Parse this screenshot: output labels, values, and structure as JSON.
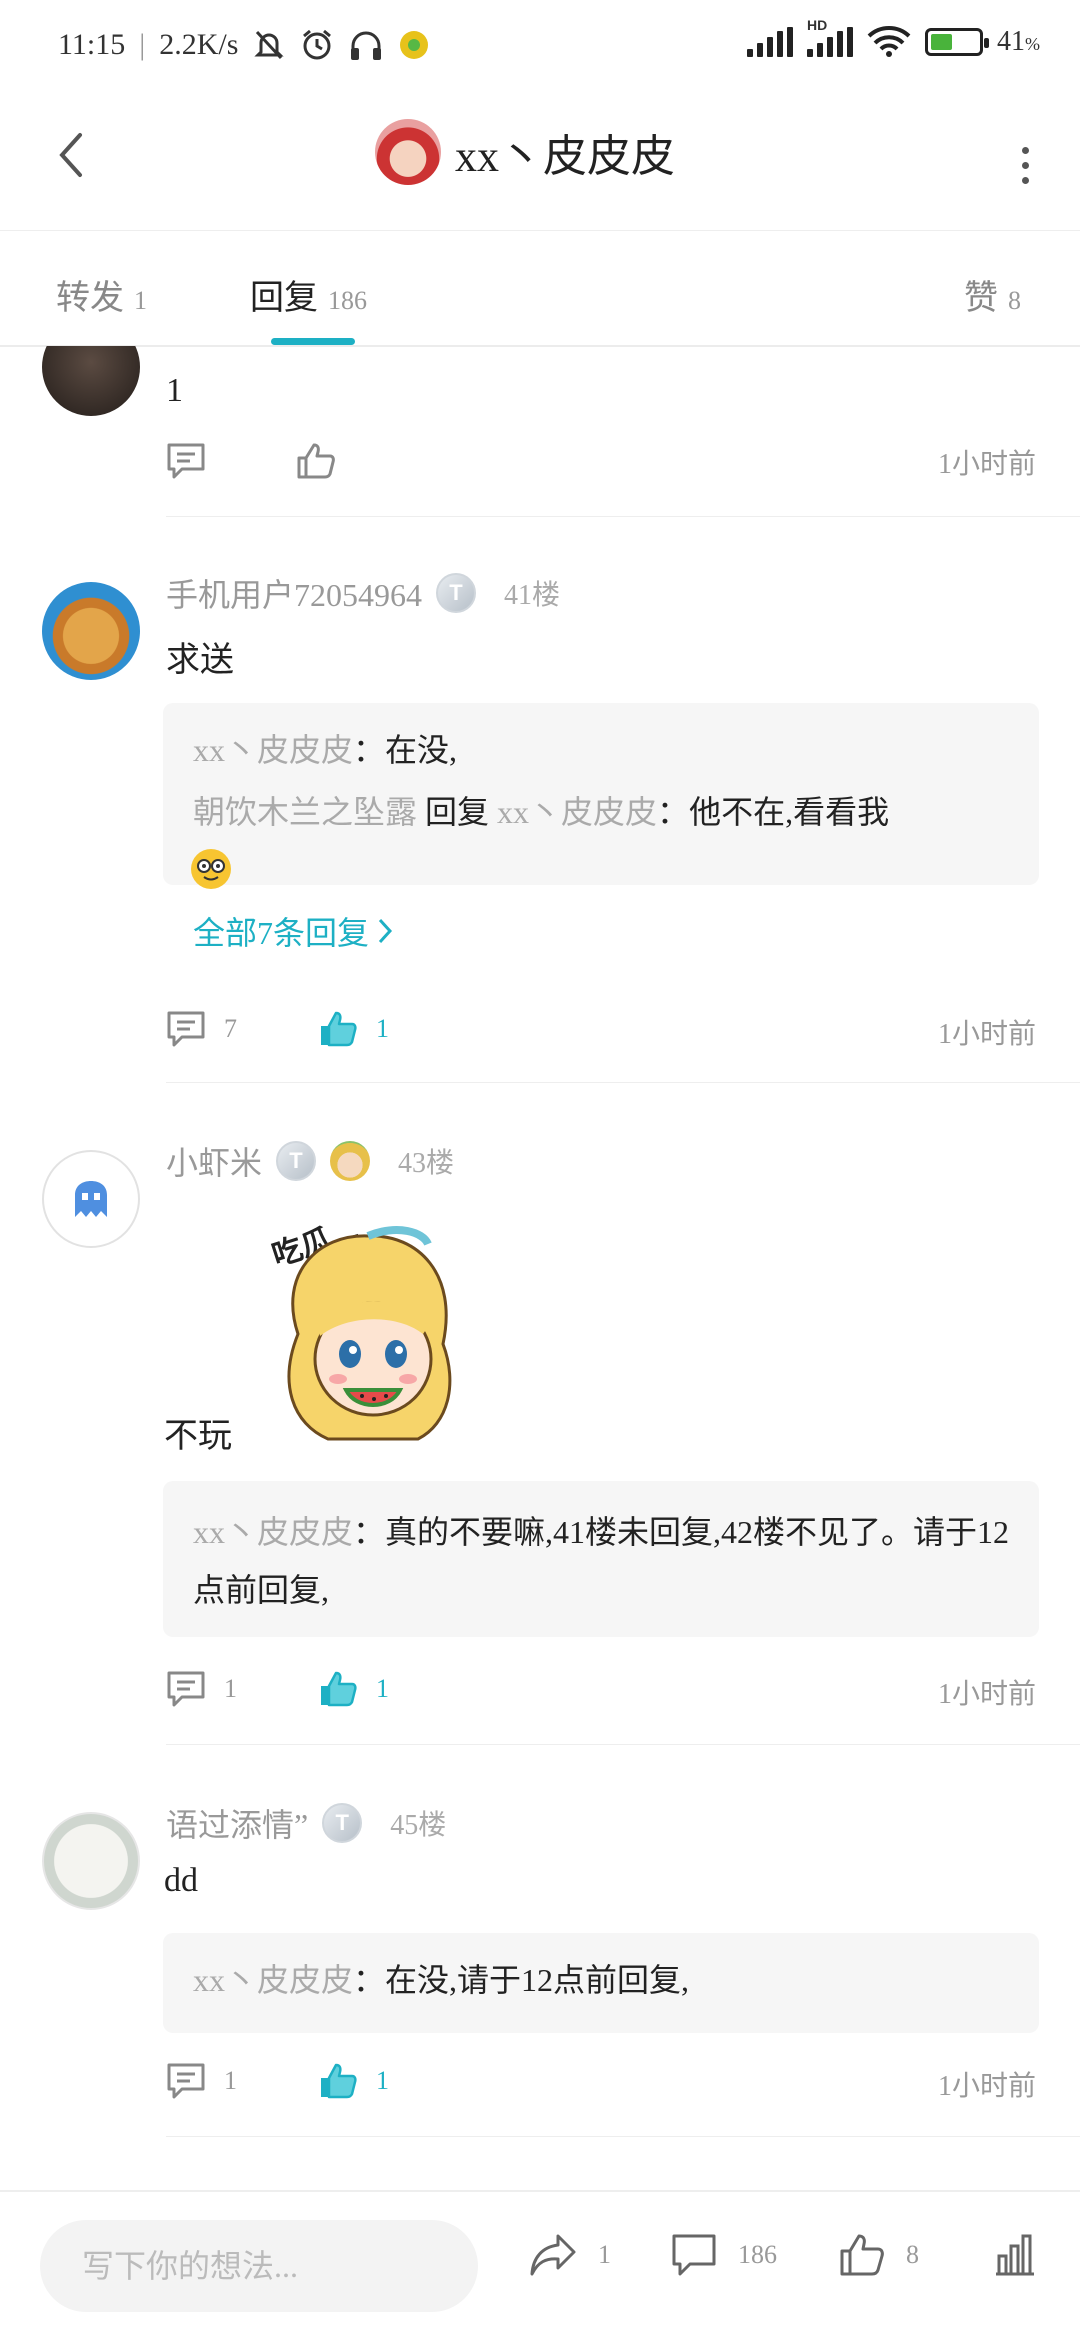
{
  "status_bar": {
    "time": "11:15",
    "speed": "2.2K/s",
    "battery_percent": "41",
    "battery_unit": "%",
    "hd_label": "HD"
  },
  "header": {
    "title": "xx丶皮皮皮"
  },
  "tabs": [
    {
      "label": "转发",
      "count": "1"
    },
    {
      "label": "回复",
      "count": "186"
    },
    {
      "label": "赞",
      "count": "8"
    }
  ],
  "feed": {
    "partial": {
      "text": "1",
      "time": "1小时前"
    },
    "comments": [
      {
        "name": "手机用户72054964",
        "badge": "T",
        "floor": "41楼",
        "text": "求送",
        "replies": [
          {
            "name": "xx丶皮皮皮",
            "sep": "：",
            "text": "在没,"
          },
          {
            "name": "朝饮木兰之坠露",
            "mid": " 回复 ",
            "target": "xx丶皮皮皮",
            "sep": "：",
            "text": "他不在,看看我"
          }
        ],
        "more_replies": "全部7条回复",
        "reply_count": "7",
        "like_count": "1",
        "time": "1小时前"
      },
      {
        "name": "小虾米",
        "badge": "T",
        "floor": "43楼",
        "text": "不玩",
        "sticker_text": "吃瓜…",
        "replies": [
          {
            "name": "xx丶皮皮皮",
            "sep": "：",
            "text": "真的不要嘛,41楼未回复,42楼不见了。请于12点前回复,"
          }
        ],
        "reply_count": "1",
        "like_count": "1",
        "time": "1小时前"
      },
      {
        "name": "语过添情”",
        "badge": "T",
        "floor": "45楼",
        "text": "dd",
        "replies": [
          {
            "name": "xx丶皮皮皮",
            "sep": "：",
            "text": "在没,请于12点前回复,"
          }
        ],
        "reply_count": "1",
        "like_count": "1",
        "time": "1小时前"
      }
    ]
  },
  "bottom_bar": {
    "placeholder": "写下你的想法...",
    "share_count": "1",
    "comment_count": "186",
    "like_count": "8"
  },
  "colors": {
    "accent": "#1db0c4",
    "battery": "#49b33b"
  }
}
